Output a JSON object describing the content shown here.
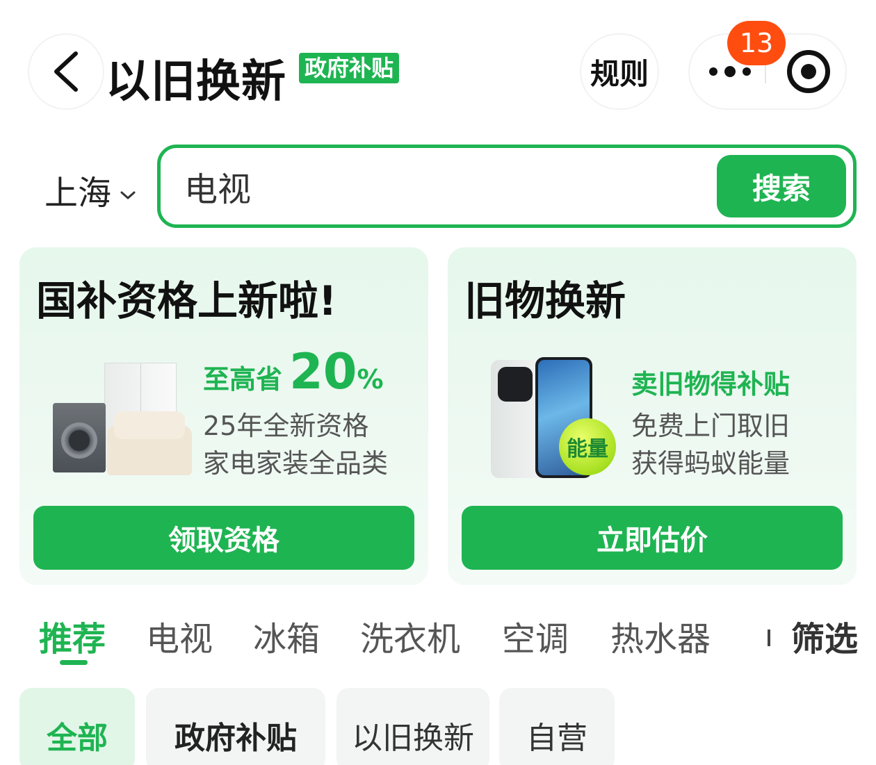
{
  "header": {
    "title": "以旧换新",
    "badge": "政府补贴",
    "rules_label": "规则",
    "notification_count": "13"
  },
  "search": {
    "city": "上海",
    "value": "电视",
    "button_label": "搜索"
  },
  "cards": {
    "left": {
      "title": "国补资格上新啦!",
      "save_prefix": "至高省",
      "save_value": "20",
      "save_unit": "%",
      "line1": "25年全新资格",
      "line2": "家电家装全品类",
      "cta": "领取资格"
    },
    "right": {
      "title": "旧物换新",
      "promo": "卖旧物得补贴",
      "line1": "免费上门取旧",
      "line2": "获得蚂蚁能量",
      "energy_badge": "能量",
      "cta": "立即估价"
    }
  },
  "tabs": {
    "items": [
      "推荐",
      "电视",
      "冰箱",
      "洗衣机",
      "空调",
      "热水器"
    ],
    "active_index": 0,
    "filter_label": "筛选"
  },
  "chips": {
    "items": [
      "全部",
      "政府补贴",
      "以旧换新",
      "自营"
    ],
    "active_index": 0
  },
  "colors": {
    "brand_green": "#1fb452",
    "badge_orange": "#ff4d10"
  },
  "icons": [
    "back-arrow-icon",
    "more-dots-icon",
    "record-target-icon",
    "chevron-down-icon"
  ]
}
